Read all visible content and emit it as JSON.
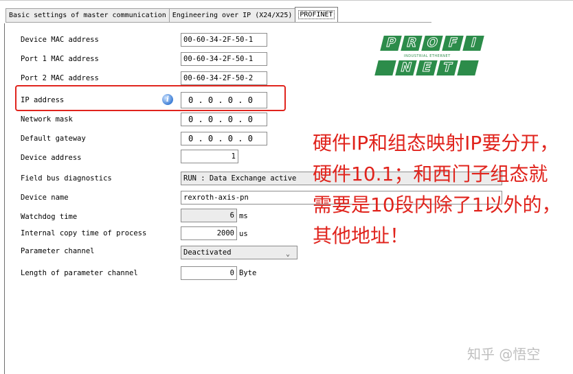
{
  "tabs": [
    {
      "label": "Basic settings of master communication",
      "active": false
    },
    {
      "label": "Engineering over IP (X24/X25)",
      "active": false
    },
    {
      "label": "PROFINET",
      "active": true
    }
  ],
  "fields": {
    "mac": {
      "label": "Device MAC address",
      "value": "00-60-34-2F-50-1"
    },
    "port1": {
      "label": "Port 1 MAC address",
      "value": "00-60-34-2F-50-1"
    },
    "port2": {
      "label": "Port 2 MAC address",
      "value": "00-60-34-2F-50-2"
    },
    "ip": {
      "label": "IP address",
      "value": "0 . 0 . 0 . 0"
    },
    "netmask": {
      "label": "Network mask",
      "value": "0 . 0 . 0 . 0"
    },
    "gateway": {
      "label": "Default gateway",
      "value": "0 . 0 . 0 . 0"
    },
    "device_address": {
      "label": "Device address",
      "value": "1"
    },
    "diagnostics": {
      "label": "Field bus diagnostics",
      "value": "RUN : Data Exchange active"
    },
    "device_name": {
      "label": "Device name",
      "value": "rexroth-axis-pn"
    },
    "watchdog": {
      "label": "Watchdog time",
      "value": "6",
      "unit": "ms"
    },
    "copy_time": {
      "label": "Internal copy time of process",
      "value": "2000",
      "unit": "us"
    },
    "param_channel": {
      "label": "Parameter channel",
      "value": "Deactivated"
    },
    "param_length": {
      "label": "Length of parameter channel",
      "value": "0",
      "unit": "Byte"
    }
  },
  "logo": {
    "row1": [
      "P",
      "R",
      "O",
      "F",
      "I"
    ],
    "tagline": "INDUSTRIAL ETHERNET",
    "row2": [
      "",
      "N",
      "E",
      "T",
      ""
    ]
  },
  "annotation": "硬件IP和组态映射IP要分开，硬件10.1；和西门子组态就需要是10段内除了1以外的，其他地址！",
  "watermark": "知乎 @悟空",
  "colors": {
    "annotation": "#e0231c",
    "logo": "#2c8c4a"
  }
}
